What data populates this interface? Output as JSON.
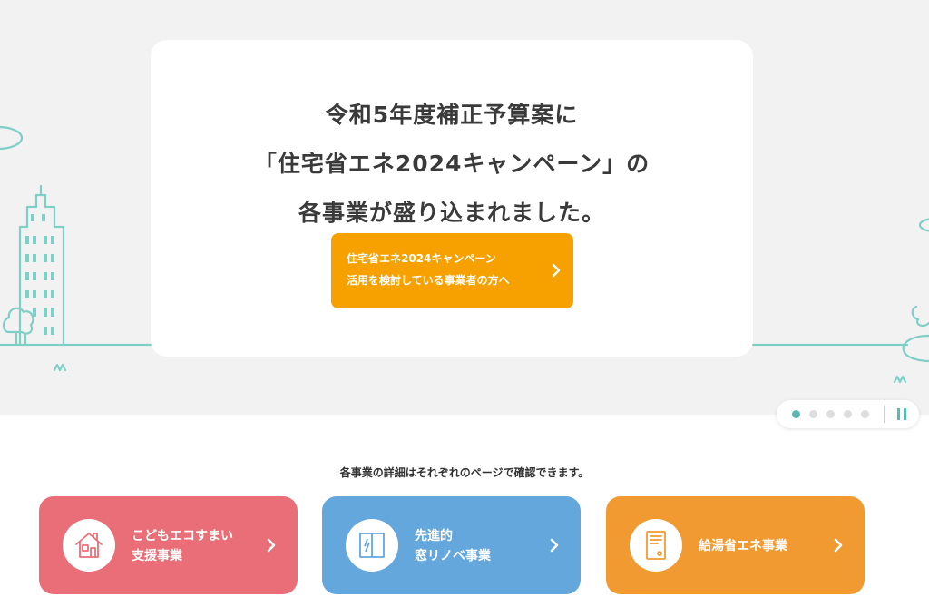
{
  "hero": {
    "heading": {
      "line1": "令和5年度補正予算案に",
      "line2": "「住宅省エネ2024キャンペーン」の",
      "line3": "各事業が盛り込まれました。"
    },
    "cta": {
      "line1": "住宅省エネ2024キャンペーン",
      "line2": "活用を検討している事業者の方へ"
    }
  },
  "carousel": {
    "total_slides": 5,
    "active_slide": 1
  },
  "intro_text": "各事業の詳細はそれぞれのページで確認できます。",
  "programs": [
    {
      "line1": "こどもエコすまい",
      "line2": "支援事業",
      "icon": "house-icon",
      "color": "#ea6e78"
    },
    {
      "line1": "先進的",
      "line2": "窓リノベ事業",
      "icon": "window-icon",
      "color": "#64a7dc"
    },
    {
      "line1": "給湯省エネ事業",
      "line2": "",
      "icon": "water-heater-icon",
      "color": "#f29a32"
    }
  ],
  "colors": {
    "accent_teal": "#5bb9b3",
    "cta_orange": "#f6a100",
    "hero_background": "#f2f2f2"
  }
}
